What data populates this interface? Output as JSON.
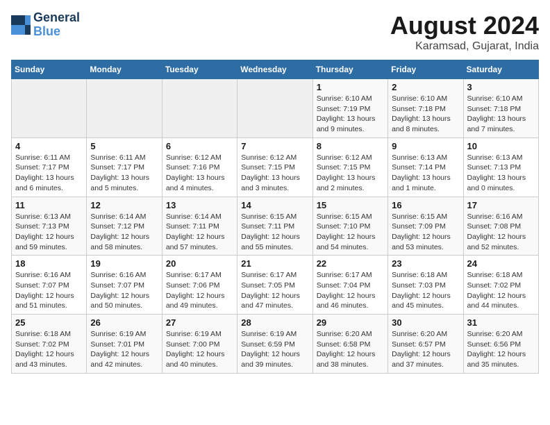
{
  "header": {
    "logo_line1": "General",
    "logo_line2": "Blue",
    "month_year": "August 2024",
    "location": "Karamsad, Gujarat, India"
  },
  "weekdays": [
    "Sunday",
    "Monday",
    "Tuesday",
    "Wednesday",
    "Thursday",
    "Friday",
    "Saturday"
  ],
  "weeks": [
    [
      {
        "day": "",
        "info": ""
      },
      {
        "day": "",
        "info": ""
      },
      {
        "day": "",
        "info": ""
      },
      {
        "day": "",
        "info": ""
      },
      {
        "day": "1",
        "info": "Sunrise: 6:10 AM\nSunset: 7:19 PM\nDaylight: 13 hours\nand 9 minutes."
      },
      {
        "day": "2",
        "info": "Sunrise: 6:10 AM\nSunset: 7:18 PM\nDaylight: 13 hours\nand 8 minutes."
      },
      {
        "day": "3",
        "info": "Sunrise: 6:10 AM\nSunset: 7:18 PM\nDaylight: 13 hours\nand 7 minutes."
      }
    ],
    [
      {
        "day": "4",
        "info": "Sunrise: 6:11 AM\nSunset: 7:17 PM\nDaylight: 13 hours\nand 6 minutes."
      },
      {
        "day": "5",
        "info": "Sunrise: 6:11 AM\nSunset: 7:17 PM\nDaylight: 13 hours\nand 5 minutes."
      },
      {
        "day": "6",
        "info": "Sunrise: 6:12 AM\nSunset: 7:16 PM\nDaylight: 13 hours\nand 4 minutes."
      },
      {
        "day": "7",
        "info": "Sunrise: 6:12 AM\nSunset: 7:15 PM\nDaylight: 13 hours\nand 3 minutes."
      },
      {
        "day": "8",
        "info": "Sunrise: 6:12 AM\nSunset: 7:15 PM\nDaylight: 13 hours\nand 2 minutes."
      },
      {
        "day": "9",
        "info": "Sunrise: 6:13 AM\nSunset: 7:14 PM\nDaylight: 13 hours\nand 1 minute."
      },
      {
        "day": "10",
        "info": "Sunrise: 6:13 AM\nSunset: 7:13 PM\nDaylight: 13 hours\nand 0 minutes."
      }
    ],
    [
      {
        "day": "11",
        "info": "Sunrise: 6:13 AM\nSunset: 7:13 PM\nDaylight: 12 hours\nand 59 minutes."
      },
      {
        "day": "12",
        "info": "Sunrise: 6:14 AM\nSunset: 7:12 PM\nDaylight: 12 hours\nand 58 minutes."
      },
      {
        "day": "13",
        "info": "Sunrise: 6:14 AM\nSunset: 7:11 PM\nDaylight: 12 hours\nand 57 minutes."
      },
      {
        "day": "14",
        "info": "Sunrise: 6:15 AM\nSunset: 7:11 PM\nDaylight: 12 hours\nand 55 minutes."
      },
      {
        "day": "15",
        "info": "Sunrise: 6:15 AM\nSunset: 7:10 PM\nDaylight: 12 hours\nand 54 minutes."
      },
      {
        "day": "16",
        "info": "Sunrise: 6:15 AM\nSunset: 7:09 PM\nDaylight: 12 hours\nand 53 minutes."
      },
      {
        "day": "17",
        "info": "Sunrise: 6:16 AM\nSunset: 7:08 PM\nDaylight: 12 hours\nand 52 minutes."
      }
    ],
    [
      {
        "day": "18",
        "info": "Sunrise: 6:16 AM\nSunset: 7:07 PM\nDaylight: 12 hours\nand 51 minutes."
      },
      {
        "day": "19",
        "info": "Sunrise: 6:16 AM\nSunset: 7:07 PM\nDaylight: 12 hours\nand 50 minutes."
      },
      {
        "day": "20",
        "info": "Sunrise: 6:17 AM\nSunset: 7:06 PM\nDaylight: 12 hours\nand 49 minutes."
      },
      {
        "day": "21",
        "info": "Sunrise: 6:17 AM\nSunset: 7:05 PM\nDaylight: 12 hours\nand 47 minutes."
      },
      {
        "day": "22",
        "info": "Sunrise: 6:17 AM\nSunset: 7:04 PM\nDaylight: 12 hours\nand 46 minutes."
      },
      {
        "day": "23",
        "info": "Sunrise: 6:18 AM\nSunset: 7:03 PM\nDaylight: 12 hours\nand 45 minutes."
      },
      {
        "day": "24",
        "info": "Sunrise: 6:18 AM\nSunset: 7:02 PM\nDaylight: 12 hours\nand 44 minutes."
      }
    ],
    [
      {
        "day": "25",
        "info": "Sunrise: 6:18 AM\nSunset: 7:02 PM\nDaylight: 12 hours\nand 43 minutes."
      },
      {
        "day": "26",
        "info": "Sunrise: 6:19 AM\nSunset: 7:01 PM\nDaylight: 12 hours\nand 42 minutes."
      },
      {
        "day": "27",
        "info": "Sunrise: 6:19 AM\nSunset: 7:00 PM\nDaylight: 12 hours\nand 40 minutes."
      },
      {
        "day": "28",
        "info": "Sunrise: 6:19 AM\nSunset: 6:59 PM\nDaylight: 12 hours\nand 39 minutes."
      },
      {
        "day": "29",
        "info": "Sunrise: 6:20 AM\nSunset: 6:58 PM\nDaylight: 12 hours\nand 38 minutes."
      },
      {
        "day": "30",
        "info": "Sunrise: 6:20 AM\nSunset: 6:57 PM\nDaylight: 12 hours\nand 37 minutes."
      },
      {
        "day": "31",
        "info": "Sunrise: 6:20 AM\nSunset: 6:56 PM\nDaylight: 12 hours\nand 35 minutes."
      }
    ]
  ]
}
